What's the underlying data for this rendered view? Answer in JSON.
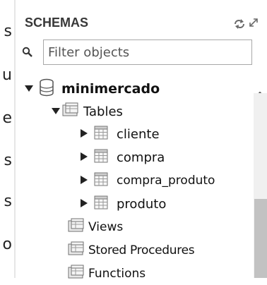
{
  "left_fragments": [
    "s",
    "u",
    "e",
    "s",
    "s",
    "o"
  ],
  "schemas_panel": {
    "title": "SCHEMAS",
    "filter": {
      "placeholder": "Filter objects",
      "value": ""
    },
    "tree": {
      "schema": "minimercado",
      "tables_label": "Tables",
      "tables": [
        "cliente",
        "compra",
        "compra_produto",
        "produto"
      ],
      "views_label": "Views",
      "procedures_label": "Stored Procedures",
      "functions_label": "Functions"
    }
  },
  "colors": {
    "accent": "#2f6db5",
    "icon_gray": "#7a7a7a",
    "scroll_thumb": "#c2c2c2"
  },
  "icons": {
    "refresh": "refresh-icon",
    "expand": "expand-icon",
    "search": "search-icon",
    "database": "database-icon",
    "folder": "folder-icon",
    "table": "table-icon"
  }
}
